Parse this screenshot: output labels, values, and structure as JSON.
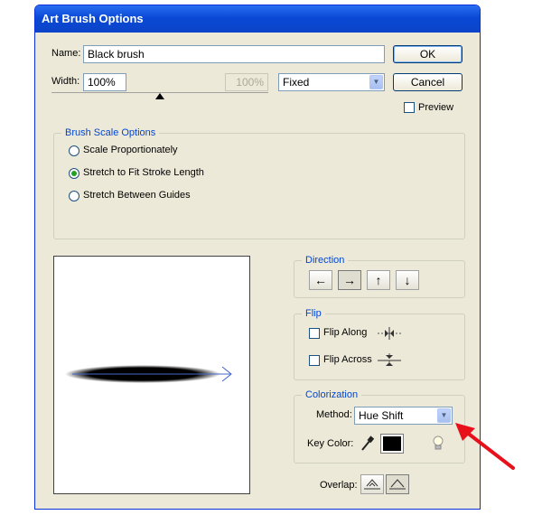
{
  "dialog": {
    "title": "Art Brush Options",
    "name_label": "Name:",
    "name_value": "Black brush",
    "width_label": "Width:",
    "width_value": "100%",
    "width_secondary_value": "100%",
    "width_mode": "Fixed",
    "ok_label": "OK",
    "cancel_label": "Cancel",
    "preview_label": "Preview",
    "preview_checked": false
  },
  "scale_options": {
    "legend": "Brush Scale Options",
    "options": [
      {
        "label": "Scale Proportionately",
        "selected": false
      },
      {
        "label": "Stretch to Fit Stroke Length",
        "selected": true
      },
      {
        "label": "Stretch Between Guides",
        "selected": false
      }
    ]
  },
  "direction": {
    "legend": "Direction",
    "buttons": [
      {
        "glyph": "←",
        "selected": false
      },
      {
        "glyph": "→",
        "selected": true
      },
      {
        "glyph": "↑",
        "selected": false
      },
      {
        "glyph": "↓",
        "selected": false
      }
    ]
  },
  "flip": {
    "legend": "Flip",
    "along_label": "Flip Along",
    "across_label": "Flip Across"
  },
  "colorization": {
    "legend": "Colorization",
    "method_label": "Method:",
    "method_value": "Hue Shift",
    "key_color_label": "Key Color:",
    "key_color": "#000000"
  },
  "overlap": {
    "label": "Overlap:"
  },
  "colors": {
    "annotation_arrow": "#e8101a",
    "title_bar": "#0a49d6",
    "group_legend": "#0046d5"
  }
}
